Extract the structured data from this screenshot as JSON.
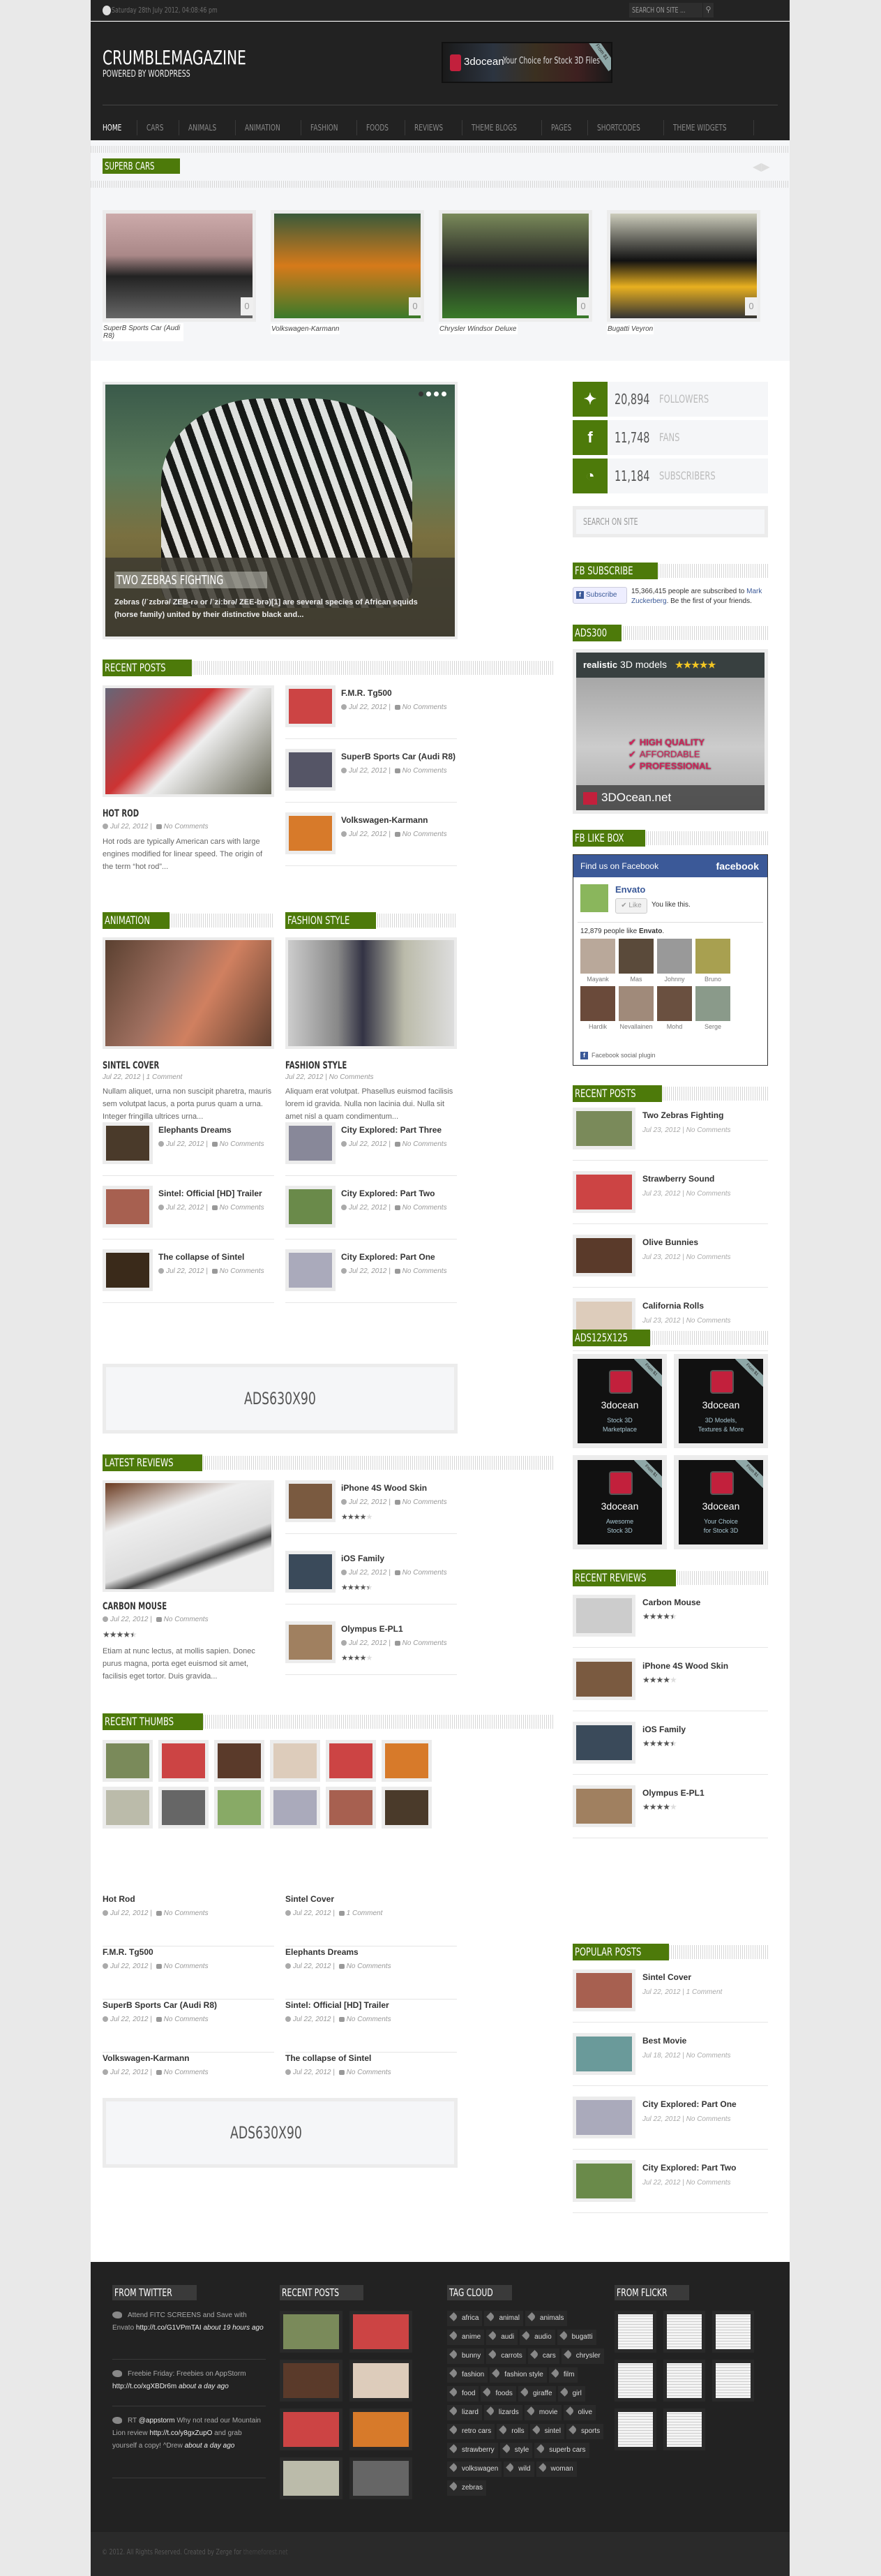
{
  "topbar": {
    "date": "Saturday 28th July 2012, 04:08:46 pm",
    "search_placeholder": "SEARCH ON SITE ..."
  },
  "header": {
    "site_title": "CRUMBLEMAGAZINE",
    "tagline": "POWERED BY WORDPRESS",
    "banner": {
      "brand": "3docean",
      "slogan": "Your Choice for Stock 3D Files",
      "ribbon": "From $1"
    }
  },
  "nav": [
    "HOME",
    "CARS",
    "ANIMALS",
    "ANIMATION",
    "FASHION",
    "FOODS",
    "REVIEWS",
    "THEME BLOGS",
    "PAGES",
    "SHORTCODES",
    "THEME WIDGETS"
  ],
  "superb_cars": {
    "title": "SUPERB CARS",
    "items": [
      {
        "caption": "SuperB Sports Car (Audi R8)",
        "count": "0"
      },
      {
        "caption": "Volkswagen-Karmann",
        "count": "0"
      },
      {
        "caption": "Chrysler Windsor Deluxe",
        "count": "0"
      },
      {
        "caption": "Bugatti Veyron",
        "count": "0"
      }
    ]
  },
  "slider": {
    "title": "TWO ZEBRAS FIGHTING",
    "excerpt": "Zebras (/ˈzɛbrə/ ZEB-rə or /ˈziːbrə/ ZEE-brə)[1] are several species of African equids (horse family) united by their distinctive black and..."
  },
  "recent_posts": {
    "title": "RECENT POSTS",
    "featured": {
      "title": "HOT ROD",
      "date": "Jul 22, 2012",
      "comments": "No Comments",
      "excerpt": "Hot rods are typically American cars with large engines modified for linear speed. The origin of the term “hot rod”..."
    },
    "items": [
      {
        "title": "F.M.R. Tg500",
        "date": "Jul 22, 2012",
        "comments": "No Comments"
      },
      {
        "title": "SuperB Sports Car (Audi R8)",
        "date": "Jul 22, 2012",
        "comments": "No Comments"
      },
      {
        "title": "Volkswagen-Karmann",
        "date": "Jul 22, 2012",
        "comments": "No Comments"
      }
    ]
  },
  "animation": {
    "title": "ANIMATION",
    "featured": {
      "title": "SINTEL COVER",
      "meta": "Jul 22, 2012 | 1 Comment",
      "excerpt": "Nullam aliquet, urna non suscipit pharetra, mauris sem volutpat lacus, a porta purus quam a urna. Integer fringilla ultrices urna..."
    },
    "items": [
      {
        "title": "Elephants Dreams",
        "date": "Jul 22, 2012",
        "comments": "No Comments"
      },
      {
        "title": "Sintel: Official [HD] Trailer",
        "date": "Jul 22, 2012",
        "comments": "No Comments"
      },
      {
        "title": "The collapse of Sintel",
        "date": "Jul 22, 2012",
        "comments": "No Comments"
      }
    ]
  },
  "fashion": {
    "title": "FASHION STYLE",
    "featured": {
      "title": "FASHION STYLE",
      "meta": "Jul 22, 2012 | No Comments",
      "excerpt": "Aliquam erat volutpat. Phasellus euismod facilisis lorem id gravida. Nulla non lacinia dui. Nulla sit amet nisl a quam condimentum..."
    },
    "items": [
      {
        "title": "City Explored: Part Three",
        "date": "Jul 22, 2012",
        "comments": "No Comments"
      },
      {
        "title": "City Explored: Part Two",
        "date": "Jul 22, 2012",
        "comments": "No Comments"
      },
      {
        "title": "City Explored: Part One",
        "date": "Jul 22, 2012",
        "comments": "No Comments"
      }
    ]
  },
  "ads": {
    "label_630": "ADS630X90"
  },
  "latest_reviews": {
    "title": "LATEST REVIEWS",
    "featured": {
      "title": "CARBON MOUSE",
      "date": "Jul 22, 2012",
      "comments": "No Comments",
      "rating": 4.5,
      "excerpt": "Etiam at nunc lectus, at mollis sapien. Donec purus magna, porta eget euismod sit amet, facilisis eget tortor. Duis gravida..."
    },
    "items": [
      {
        "title": "iPhone 4S Wood Skin",
        "date": "Jul 22, 2012",
        "comments": "No Comments",
        "rating": 4
      },
      {
        "title": "iOS Family",
        "date": "Jul 22, 2012",
        "comments": "No Comments",
        "rating": 4.5
      },
      {
        "title": "Olympus E-PL1",
        "date": "Jul 22, 2012",
        "comments": "No Comments",
        "rating": 4
      }
    ]
  },
  "recent_thumbs": {
    "title": "RECENT THUMBS"
  },
  "list_posts": [
    {
      "title": "Hot Rod",
      "date": "Jul 22, 2012",
      "comments": "No Comments"
    },
    {
      "title": "Sintel Cover",
      "date": "Jul 22, 2012",
      "comments": "1 Comment"
    },
    {
      "title": "F.M.R. Tg500",
      "date": "Jul 22, 2012",
      "comments": "No Comments"
    },
    {
      "title": "Elephants Dreams",
      "date": "Jul 22, 2012",
      "comments": "No Comments"
    },
    {
      "title": "SuperB Sports Car (Audi R8)",
      "date": "Jul 22, 2012",
      "comments": "No Comments"
    },
    {
      "title": "Sintel: Official [HD] Trailer",
      "date": "Jul 22, 2012",
      "comments": "No Comments"
    },
    {
      "title": "Volkswagen-Karmann",
      "date": "Jul 22, 2012",
      "comments": "No Comments"
    },
    {
      "title": "The collapse of Sintel",
      "date": "Jul 22, 2012",
      "comments": "No Comments"
    }
  ],
  "sidebar": {
    "social": [
      {
        "icon": "twitter-icon",
        "count": "20,894",
        "label": "FOLLOWERS"
      },
      {
        "icon": "facebook-icon",
        "count": "11,748",
        "label": "FANS"
      },
      {
        "icon": "rss-icon",
        "count": "11,184",
        "label": "SUBSCRIBERS"
      }
    ],
    "search_placeholder": "SEARCH ON SITE",
    "fb_subscribe": {
      "title": "FB SUBSCRIBE",
      "button": "Subscribe",
      "count_text": "15,366,415 people are subscribed to",
      "name": "Mark Zuckerberg",
      "tail": ". Be the first of your friends."
    },
    "ads300": {
      "title": "ADS300",
      "headline_bold": "realistic",
      "headline": " 3D models",
      "stars": "★★★★★",
      "points": [
        "HIGH QUALITY",
        "AFFORDABLE",
        "PROFESSIONAL"
      ],
      "footer": "3DOcean.net"
    },
    "fb_like": {
      "title": "FB LIKE BOX",
      "header": "Find us on Facebook",
      "brand": "facebook",
      "page": "Envato",
      "like": "✔ Like",
      "you_like": "You like this.",
      "count": "12,879 people like ",
      "count_name": "Envato",
      "faces": [
        "Mayank",
        "Mas",
        "Johnny",
        "Bruno",
        "Hardik",
        "Nevallainen",
        "Mohd",
        "Serge"
      ],
      "plugin": "Facebook social plugin"
    },
    "recent_posts": {
      "title": "RECENT POSTS",
      "items": [
        {
          "title": "Two Zebras Fighting",
          "meta": "Jul 23, 2012 | No Comments"
        },
        {
          "title": "Strawberry Sound",
          "meta": "Jul 23, 2012 | No Comments"
        },
        {
          "title": "Olive Bunnies",
          "meta": "Jul 23, 2012 | No Comments"
        },
        {
          "title": "California Rolls",
          "meta": "Jul 23, 2012 | No Comments"
        }
      ]
    },
    "ads125": {
      "title": "ADS125X125",
      "items": [
        {
          "brand": "3docean",
          "line1": "Stock 3D",
          "line2": "Marketplace",
          "ribbon": "From $1"
        },
        {
          "brand": "3docean",
          "line1": "3D Models,",
          "line2": "Textures & More",
          "ribbon": "From $1"
        },
        {
          "brand": "3docean",
          "line1": "Awesome",
          "line2": "Stock 3D",
          "ribbon": "From $1"
        },
        {
          "brand": "3docean",
          "line1": "Your Choice",
          "line2": "for Stock 3D",
          "ribbon": "From $1"
        }
      ]
    },
    "recent_reviews": {
      "title": "RECENT REVIEWS",
      "items": [
        {
          "title": "Carbon Mouse",
          "rating": 4.5
        },
        {
          "title": "iPhone 4S Wood Skin",
          "rating": 4
        },
        {
          "title": "iOS Family",
          "rating": 4.5
        },
        {
          "title": "Olympus E-PL1",
          "rating": 4
        }
      ]
    },
    "popular_posts": {
      "title": "POPULAR POSTS",
      "items": [
        {
          "title": "Sintel Cover",
          "meta": "Jul 22, 2012 | 1 Comment"
        },
        {
          "title": "Best Movie",
          "meta": "Jul 18, 2012 | No Comments"
        },
        {
          "title": "City Explored: Part One",
          "meta": "Jul 22, 2012 | No Comments"
        },
        {
          "title": "City Explored: Part Two",
          "meta": "Jul 22, 2012 | No Comments"
        }
      ]
    }
  },
  "footer": {
    "twitter_title": "FROM TWITTER",
    "tweets": [
      {
        "text": "Attend FITC SCREENS and Save with Envato ",
        "link": "http://t.co/G1VPmTAI",
        "time": " about 19 hours ago"
      },
      {
        "text": "Freebie Friday: Freebies on AppStorm ",
        "link": "http://t.co/xgXBDr6m",
        "time": " about a day ago"
      },
      {
        "text": "RT ",
        "mention": "@appstorm",
        "text2": " Why not read our Mountain Lion review ",
        "link": "http://t.co/y8gxZupO",
        "text3": " and grab yourself a copy! ^Drew",
        "time": " about a day ago"
      }
    ],
    "recent_title": "RECENT POSTS",
    "tags_title": "TAG CLOUD",
    "tags": [
      "africa",
      "animal",
      "animals",
      "anime",
      "audi",
      "audio",
      "bugatti",
      "bunny",
      "carrots",
      "cars",
      "chrysler",
      "fashion",
      "fashion style",
      "film",
      "food",
      "foods",
      "giraffe",
      "girl",
      "lizard",
      "lizards",
      "movie",
      "olive",
      "retro cars",
      "rolls",
      "sintel",
      "sports",
      "strawberry",
      "style",
      "superb cars",
      "volkswagen",
      "wild",
      "woman",
      "zebras"
    ],
    "flickr_title": "FROM FLICKR",
    "copyright": "© 2012. All Rights Reserved. Created by Zerge for ",
    "copyright_link": "themeforest.net"
  }
}
